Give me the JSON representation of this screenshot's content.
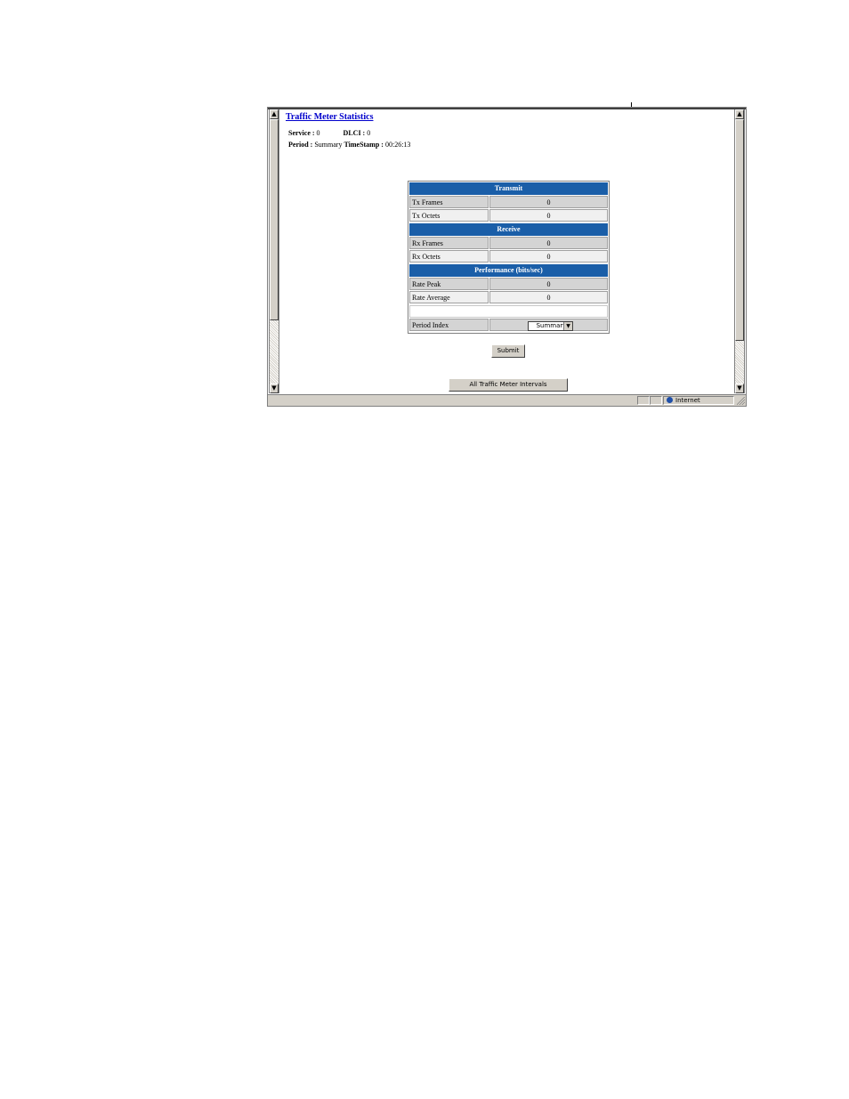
{
  "page": {
    "title": "Traffic Meter Statistics",
    "service_label": "Service :",
    "service_value": "0",
    "dlci_label": "DLCI :",
    "dlci_value": "0",
    "period_label": "Period :",
    "period_value": "Summary",
    "timestamp_label": "TimeStamp :",
    "timestamp_value": "00:26:13"
  },
  "table": {
    "transmit_header": "Transmit",
    "tx_frames_label": "Tx Frames",
    "tx_frames_value": "0",
    "tx_octets_label": "Tx Octets",
    "tx_octets_value": "0",
    "receive_header": "Receive",
    "rx_frames_label": "Rx Frames",
    "rx_frames_value": "0",
    "rx_octets_label": "Rx Octets",
    "rx_octets_value": "0",
    "performance_header": "Performance (bits/sec)",
    "rate_peak_label": "Rate Peak",
    "rate_peak_value": "0",
    "rate_average_label": "Rate Average",
    "rate_average_value": "0",
    "period_index_label": "Period Index",
    "period_index_selected": "Summary"
  },
  "buttons": {
    "submit": "Submit",
    "all_intervals": "All Traffic Meter Intervals"
  },
  "statusbar": {
    "zone": "Internet"
  },
  "icons": {
    "scroll_up": "▲",
    "scroll_down": "▼",
    "dropdown": "▼"
  }
}
